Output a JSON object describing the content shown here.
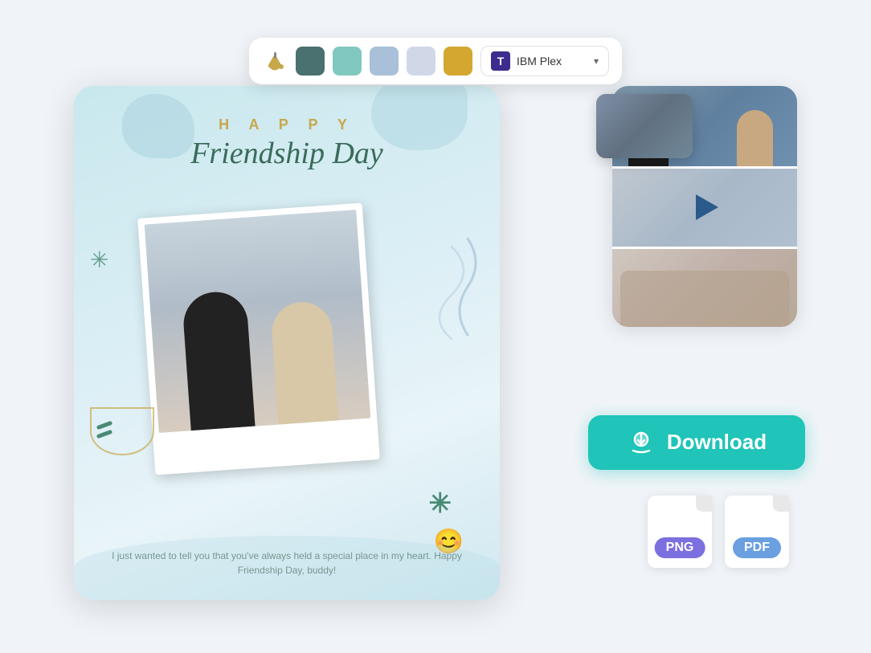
{
  "toolbar": {
    "colors": [
      {
        "name": "dark-teal",
        "hex": "#4a7070"
      },
      {
        "name": "light-teal",
        "hex": "#80c8c0"
      },
      {
        "name": "light-blue",
        "hex": "#a8c0d8"
      },
      {
        "name": "light-gray-blue",
        "hex": "#d0d8e8"
      },
      {
        "name": "gold",
        "hex": "#d4a830"
      }
    ],
    "font_name": "IBM Plex",
    "font_dropdown_label": "IBM Plex"
  },
  "design": {
    "happy_text": "H A P P Y",
    "title_text": "Friendship Day",
    "bottom_message": "I just wanted to tell you that you've always held a special place in my heart. Happy Friendship Day, buddy!"
  },
  "download": {
    "button_label": "Download",
    "formats": [
      "PNG",
      "PDF"
    ]
  },
  "icons": {
    "paint_bucket": "🪣",
    "font_t": "T",
    "play": "▶",
    "download": "⬇",
    "smile": "😊"
  }
}
